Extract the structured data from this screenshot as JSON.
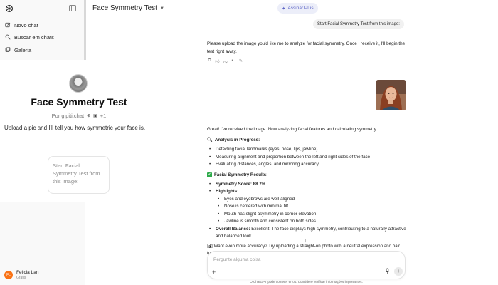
{
  "sidebar": {
    "logo_icon": "openai-logo-icon",
    "toggle_icon": "sidebar-toggle-icon",
    "items": [
      {
        "label": "Novo chat",
        "icon": "edit-icon"
      },
      {
        "label": "Buscar em chats",
        "icon": "search-icon"
      },
      {
        "label": "Galeria",
        "icon": "gallery-icon"
      }
    ],
    "user": {
      "initials": "FL",
      "name": "Felicia Lan",
      "plan": "Grátis",
      "avatar_color": "#f97316"
    }
  },
  "gpt": {
    "title": "Face Symmetry Test",
    "by": "Por gipiti.chat",
    "more_count": "+1",
    "description": "Upload a pic and I'll tell you how symmetric your face is.",
    "starter": "Start Facial Symmetry Test from this image:"
  },
  "header": {
    "title": "Face Symmetry Test",
    "upgrade_label": "Assinar Plus",
    "upgrade_color": "#5c64c6"
  },
  "messages": {
    "user1": "Start Facial Symmetry Test from this image:",
    "assistant1": "Please upload the image you'd like me to analyze for facial symmetry. Once I receive it, I'll begin the test right away.",
    "assistant2": {
      "intro": "Great! I've received the image. Now analyzing facial features and calculating symmetry...",
      "analysis_heading": "Analysis in Progress:",
      "analysis_items": [
        "Detecting facial landmarks (eyes, nose, lips, jawline)",
        "Measuring alignment and proportion between the left and right sides of the face",
        "Evaluating distances, angles, and mirroring accuracy"
      ],
      "results_heading": "Facial Symmetry Results:",
      "score_label": "Symmetry Score:",
      "score_value": "88.7%",
      "highlights_label": "Highlights:",
      "highlights": [
        "Eyes and eyebrows are well-aligned",
        "Nose is centered with minimal tilt",
        "Mouth has slight asymmetry in corner elevation",
        "Jawline is smooth and consistent on both sides"
      ],
      "balance_label": "Overall Balance:",
      "balance_text": "Excellent! The face displays high symmetry, contributing to a naturally attractive and balanced look.",
      "tip": "Want even more accuracy? Try uploading a straight-on photo with a neutral expression and hair tucked behind ears if possible."
    }
  },
  "composer": {
    "placeholder": "Pergunte alguma coisa",
    "footnote": "O ChatGPT pode cometer erros. Considere verificar informações importantes."
  }
}
